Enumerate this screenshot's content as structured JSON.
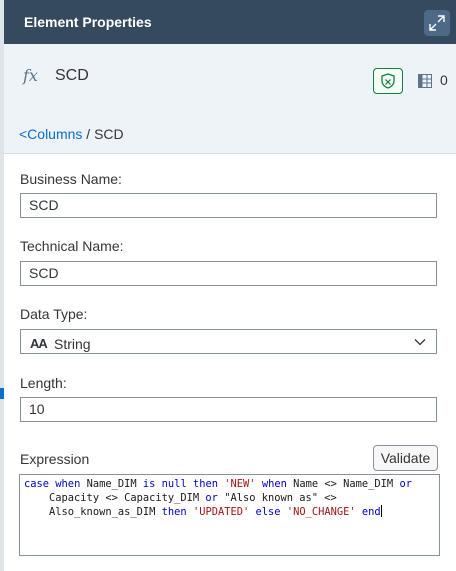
{
  "panel": {
    "title": "Element Properties",
    "expand_icon": "expand-icon"
  },
  "element": {
    "icon": "fx-icon",
    "icon_glyph": "fx",
    "name": "SCD",
    "validation_icon": "shield-check-icon",
    "columns_icon": "table-columns-icon",
    "column_count": "0"
  },
  "breadcrumb": {
    "link": "<Columns",
    "separator": " / ",
    "current": "SCD"
  },
  "fields": {
    "business_name": {
      "label": "Business Name:",
      "value": "SCD"
    },
    "technical_name": {
      "label": "Technical Name:",
      "value": "SCD"
    },
    "data_type": {
      "label": "Data Type:",
      "icon_glyph": "AA",
      "value": "String",
      "chevron_icon": "chevron-down-icon"
    },
    "length": {
      "label": "Length:",
      "value": "10"
    }
  },
  "expression": {
    "label": "Expression",
    "validate_label": "Validate",
    "lines": [
      [
        {
          "t": "case",
          "c": "kw"
        },
        {
          "t": " "
        },
        {
          "t": "when",
          "c": "kw"
        },
        {
          "t": " Name_DIM "
        },
        {
          "t": "is",
          "c": "kw"
        },
        {
          "t": " "
        },
        {
          "t": "null",
          "c": "kw"
        },
        {
          "t": " "
        },
        {
          "t": "then",
          "c": "kw"
        },
        {
          "t": " "
        },
        {
          "t": "'NEW'",
          "c": "str"
        },
        {
          "t": " "
        },
        {
          "t": "when",
          "c": "kw"
        },
        {
          "t": " Name <> Name_DIM "
        },
        {
          "t": "or",
          "c": "kw"
        }
      ],
      [
        {
          "t": "    Capacity <> Capacity_DIM "
        },
        {
          "t": "or",
          "c": "kw"
        },
        {
          "t": " \"Also known as\" <>"
        }
      ],
      [
        {
          "t": "    Also_known_as_DIM "
        },
        {
          "t": "then",
          "c": "kw"
        },
        {
          "t": " "
        },
        {
          "t": "'UPDATED'",
          "c": "str"
        },
        {
          "t": " "
        },
        {
          "t": "else",
          "c": "kw"
        },
        {
          "t": " "
        },
        {
          "t": "'NO_CHANGE'",
          "c": "str"
        },
        {
          "t": " "
        },
        {
          "t": "end",
          "c": "kw"
        }
      ]
    ]
  },
  "colors": {
    "header_bg": "#354a5f",
    "title_area_bg": "#eef3f8",
    "link": "#0a6ed1",
    "keyword": "#0000cc",
    "string": "#a31515",
    "valid_green": "#107e3e"
  }
}
